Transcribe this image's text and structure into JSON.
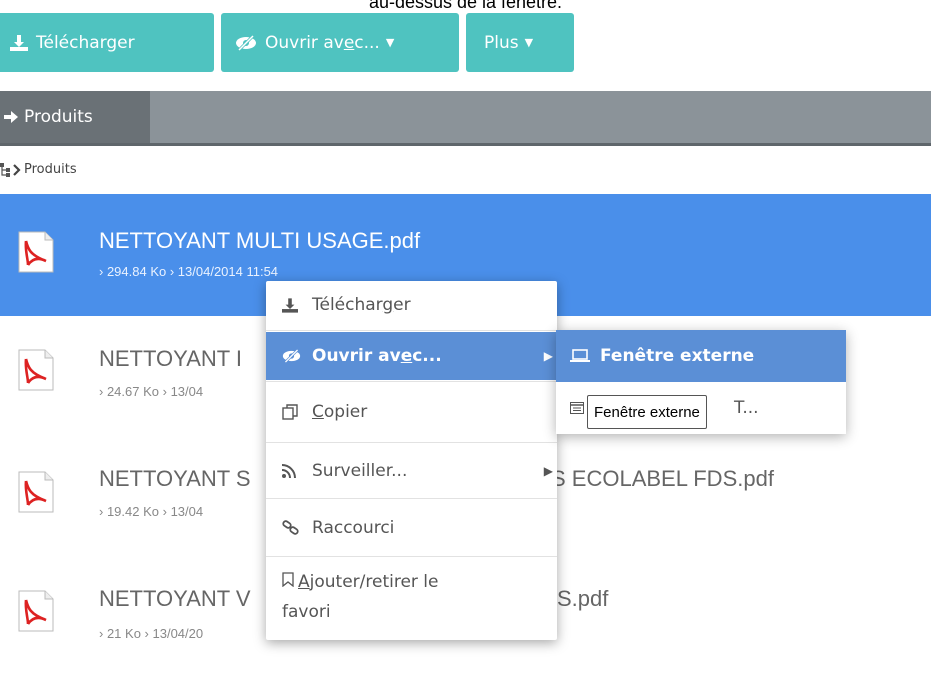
{
  "caption": "au-dessus de la fenêtre.",
  "toolbar": {
    "download": {
      "pre": "Téléchar",
      "u": "g",
      "post": "er"
    },
    "open_with": {
      "pre": "Ouvrir av",
      "u": "e",
      "post": "c..."
    },
    "more": "Plus"
  },
  "tab": {
    "label": "Produits"
  },
  "breadcrumb": {
    "label": "Produits"
  },
  "files": [
    {
      "name": "NETTOYANT MULTI USAGE.pdf",
      "size": "294.84 Ko",
      "date": "13/04/2014 11:54",
      "selected": true
    },
    {
      "name": "NETTOYANT I",
      "size": "24.67 Ko",
      "date": "13/04",
      "selected": false
    },
    {
      "name": "NETTOYANT S",
      "name_tail": "S ECOLABEL FDS.pdf",
      "size": "19.42 Ko",
      "date": "13/04",
      "selected": false
    },
    {
      "name": "NETTOYANT V",
      "name_tail": "S.pdf",
      "size": "21 Ko",
      "date": "13/04/20",
      "selected": false
    }
  ],
  "context_menu": {
    "download": {
      "pre": "Téléchar",
      "u": "g",
      "post": "er"
    },
    "open_with": {
      "pre": "Ouvrir av",
      "u": "e",
      "post": "c..."
    },
    "copy": {
      "u": "C",
      "post": "opier"
    },
    "watch": "Surveiller...",
    "shortcut": "Raccourci",
    "favorite": {
      "u": "A",
      "line1": "jouter/retirer le",
      "line2": "favori"
    }
  },
  "submenu": {
    "external_window": "Fenêtre externe",
    "second_item_tail": "T..."
  },
  "tooltip": "Fenêtre externe",
  "colors": {
    "accent_teal": "#4fc3c0",
    "selection_blue": "#4a8fea",
    "menu_highlight": "#5b8fd6",
    "tabbar": "#8b9399"
  },
  "icons": {
    "download": "download-icon",
    "open_with": "eye-slash-icon",
    "copy": "copy-icon",
    "watch": "rss-icon",
    "shortcut": "link-icon",
    "favorite": "bookmark-icon",
    "external_window": "laptop-icon",
    "file": "pdf-icon"
  }
}
